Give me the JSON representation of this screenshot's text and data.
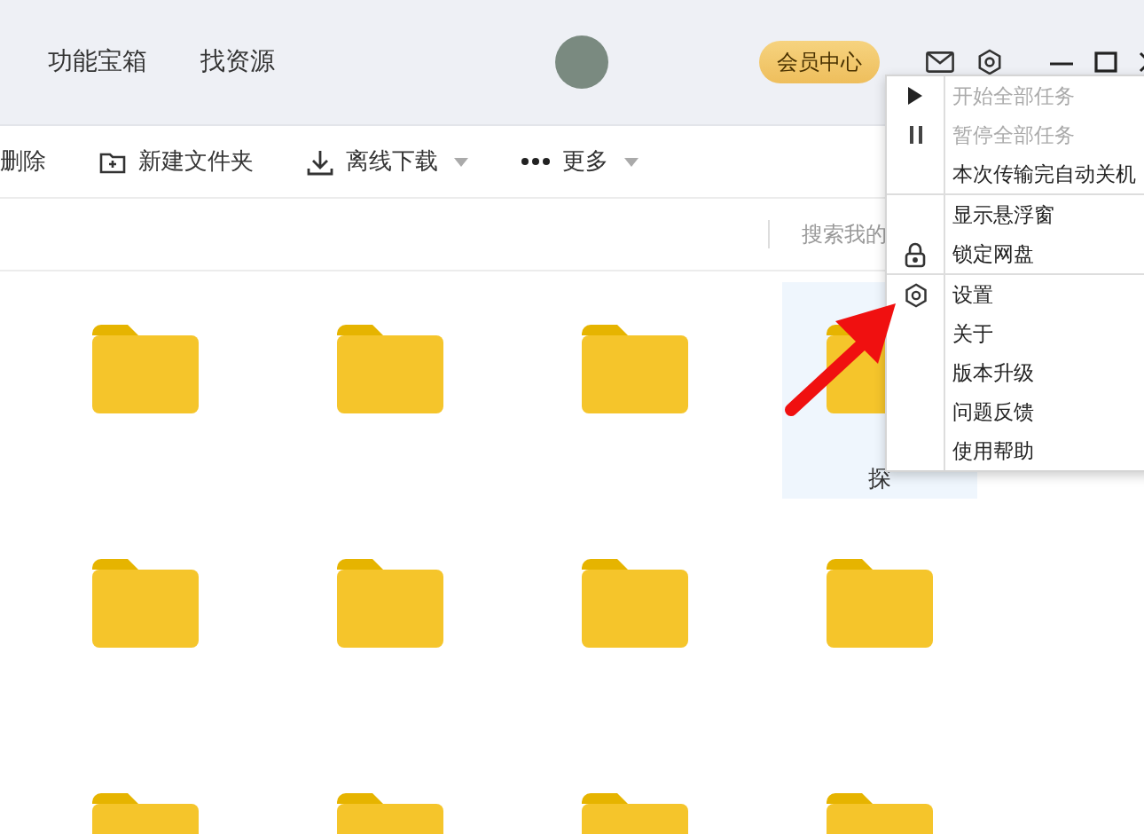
{
  "header": {
    "nav": [
      {
        "label": "功能宝箱"
      },
      {
        "label": "找资源"
      }
    ],
    "vip_button": "会员中心"
  },
  "toolbar": [
    {
      "label": "删除",
      "dropdown": false
    },
    {
      "label": "新建文件夹",
      "dropdown": false
    },
    {
      "label": "离线下载",
      "dropdown": true
    },
    {
      "label": "更多",
      "dropdown": true
    }
  ],
  "search": {
    "placeholder": "搜索我的"
  },
  "folders": [
    {
      "selected": false
    },
    {
      "selected": false
    },
    {
      "selected": false
    },
    {
      "selected": true,
      "label": "探"
    },
    {
      "selected": false
    },
    {
      "selected": false
    },
    {
      "selected": false
    },
    {
      "selected": false
    },
    {
      "selected": false
    },
    {
      "selected": false
    },
    {
      "selected": false
    },
    {
      "selected": false
    }
  ],
  "menu": [
    [
      {
        "label": "开始全部任务",
        "disabled": true
      },
      {
        "label": "暂停全部任务",
        "disabled": true
      },
      {
        "label": "本次传输完自动关机",
        "disabled": false
      }
    ],
    [
      {
        "label": "显示悬浮窗",
        "disabled": false
      },
      {
        "label": "锁定网盘",
        "disabled": false
      }
    ],
    [
      {
        "label": "设置",
        "disabled": false
      },
      {
        "label": "关于",
        "disabled": false
      },
      {
        "label": "版本升级",
        "disabled": false
      },
      {
        "label": "问题反馈",
        "disabled": false
      },
      {
        "label": "使用帮助",
        "disabled": false
      }
    ]
  ]
}
